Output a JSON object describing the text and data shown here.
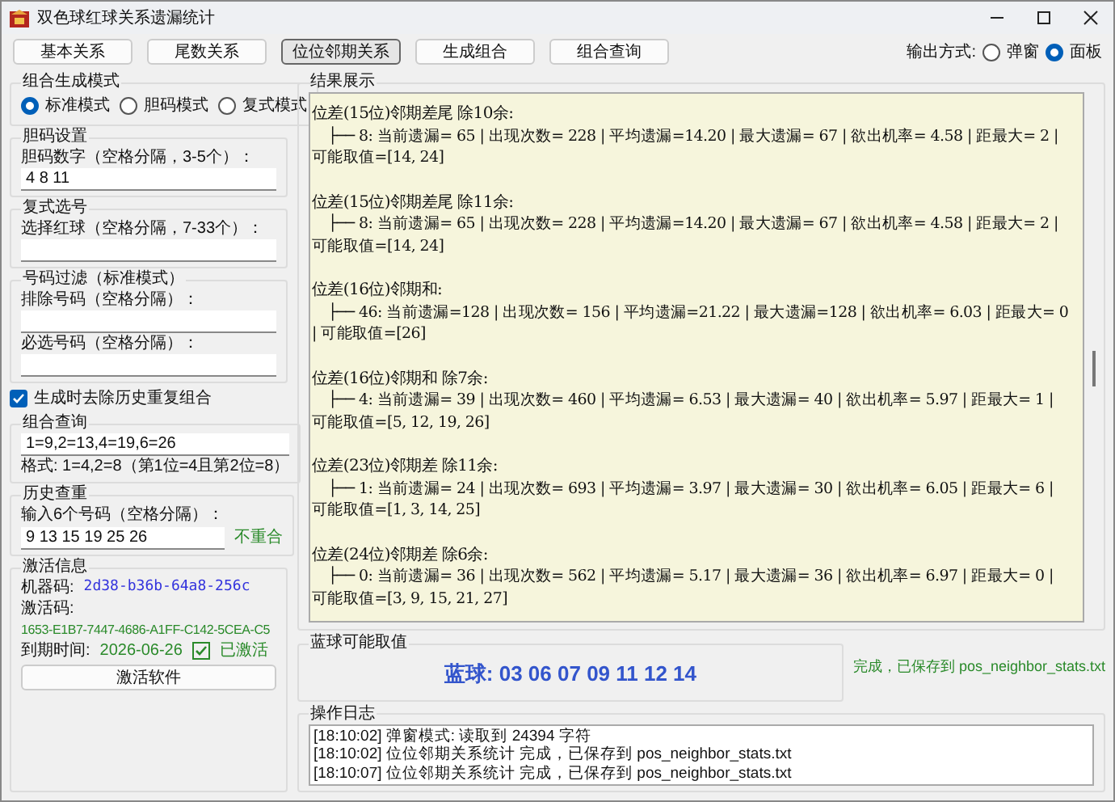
{
  "window": {
    "title": "双色球红球关系遗漏统计"
  },
  "tabs": [
    {
      "label": "基本关系",
      "selected": false
    },
    {
      "label": "尾数关系",
      "selected": false
    },
    {
      "label": "位位邻期关系",
      "selected": true
    },
    {
      "label": "生成组合",
      "selected": false
    },
    {
      "label": "组合查询",
      "selected": false
    }
  ],
  "output_mode": {
    "label": "输出方式:",
    "options": [
      {
        "label": "弹窗",
        "selected": false
      },
      {
        "label": "面板",
        "selected": true
      }
    ]
  },
  "generation_mode": {
    "title": "组合生成模式",
    "options": [
      {
        "label": "标准模式",
        "selected": true
      },
      {
        "label": "胆码模式",
        "selected": false
      },
      {
        "label": "复式模式",
        "selected": false
      }
    ]
  },
  "banker_settings": {
    "title": "胆码设置",
    "label": "胆码数字（空格分隔，3-5个）：",
    "value": "4 8 11"
  },
  "multiple_pick": {
    "title": "复式选号",
    "label": "选择红球（空格分隔，7-33个）："
  },
  "number_filter": {
    "title": "号码过滤（标准模式）",
    "fields": [
      {
        "label": "排除号码（空格分隔）："
      },
      {
        "label": "必选号码（空格分隔）："
      }
    ]
  },
  "dedupe": {
    "label": "生成时去除历史重复组合",
    "checked": true
  },
  "combo_query": {
    "title": "组合查询",
    "value": "1=9,2=13,4=19,6=26",
    "hint": "格式: 1=4,2=8（第1位=4且第2位=8）"
  },
  "history_check": {
    "title": "历史查重",
    "label": "输入6个号码（空格分隔）：",
    "value": "9 13 15 19 25 26",
    "result": "不重合"
  },
  "activation": {
    "title": "激活信息",
    "machine_label": "机器码:",
    "machine_code": "2d38-b36b-64a8-256c",
    "code_label": "激活码:",
    "code": "1653-E1B7-7447-4686-A1FF-C142-5CEA-C5",
    "expiry_label": "到期时间:",
    "expiry": "2026-06-26",
    "status": {
      "label": "已激活",
      "checked": true
    },
    "button": "激活软件"
  },
  "results": {
    "title": "结果展示",
    "blocks": [
      {
        "header": "位差(15位)邻期差尾 除10余:",
        "lines": [
          "├── 8: 当前遗漏= 65 | 出现次数= 228 | 平均遗漏=14.20 | 最大遗漏= 67 | 欲出机率= 4.58 | 距最大=  2 |",
          "可能取值=[14, 24]"
        ]
      },
      {
        "header": "位差(15位)邻期差尾 除11余:",
        "lines": [
          "├── 8: 当前遗漏= 65 | 出现次数= 228 | 平均遗漏=14.20 | 最大遗漏= 67 | 欲出机率= 4.58 | 距最大=  2 |",
          "可能取值=[14, 24]"
        ]
      },
      {
        "header": "位差(16位)邻期和:",
        "lines": [
          "├── 46: 当前遗漏=128 | 出现次数= 156 | 平均遗漏=21.22 | 最大遗漏=128 | 欲出机率= 6.03 | 距最大=  0",
          "| 可能取值=[26]"
        ]
      },
      {
        "header": "位差(16位)邻期和 除7余:",
        "lines": [
          "├── 4: 当前遗漏= 39 | 出现次数= 460 | 平均遗漏= 6.53 | 最大遗漏= 40 | 欲出机率= 5.97 | 距最大=  1 |",
          "可能取值=[5, 12, 19, 26]"
        ]
      },
      {
        "header": "位差(23位)邻期差 除11余:",
        "lines": [
          "├── 1: 当前遗漏= 24 | 出现次数= 693 | 平均遗漏= 3.97 | 最大遗漏= 30 | 欲出机率= 6.05 | 距最大=  6 |",
          "可能取值=[1, 3, 14, 25]"
        ]
      },
      {
        "header": "位差(24位)邻期差 除6余:",
        "lines": [
          "├── 0: 当前遗漏= 36 | 出现次数= 562 | 平均遗漏= 5.17 | 最大遗漏= 36 | 欲出机率= 6.97 | 距最大=  0 |",
          "可能取值=[3, 9, 15, 21, 27]"
        ]
      }
    ]
  },
  "blue_ball": {
    "title": "蓝球可能取值",
    "text": "蓝球: 03 06 07 09 11 12 14"
  },
  "status": "完成，已保存到 pos_neighbor_stats.txt",
  "log": {
    "title": "操作日志",
    "lines": [
      "[18:10:02] 弹窗模式: 读取到 24394 字符",
      "[18:10:02] 位位邻期关系统计 完成，已保存到 pos_neighbor_stats.txt",
      "[18:10:07] 位位邻期关系统计 完成，已保存到 pos_neighbor_stats.txt"
    ]
  }
}
